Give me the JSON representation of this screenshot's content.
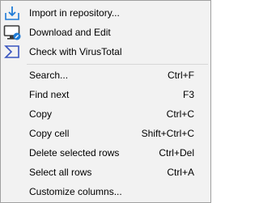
{
  "menu": {
    "items_top": [
      {
        "label": "Import in repository...",
        "icon": "import-download-icon"
      },
      {
        "label": "Download and Edit",
        "icon": "monitor-edit-icon"
      },
      {
        "label": "Check with VirusTotal",
        "icon": "virustotal-icon"
      }
    ],
    "items_bottom": [
      {
        "label": "Search...",
        "shortcut": "Ctrl+F"
      },
      {
        "label": "Find next",
        "shortcut": "F3"
      },
      {
        "label": "Copy",
        "shortcut": "Ctrl+C"
      },
      {
        "label": "Copy cell",
        "shortcut": "Shift+Ctrl+C"
      },
      {
        "label": "Delete selected rows",
        "shortcut": "Ctrl+Del"
      },
      {
        "label": "Select all rows",
        "shortcut": "Ctrl+A"
      },
      {
        "label": "Customize columns...",
        "shortcut": ""
      }
    ],
    "colors": {
      "icon_blue": "#1f7bd6",
      "virustotal_blue": "#3954bf",
      "monitor_dark": "#3a3a3a"
    }
  }
}
